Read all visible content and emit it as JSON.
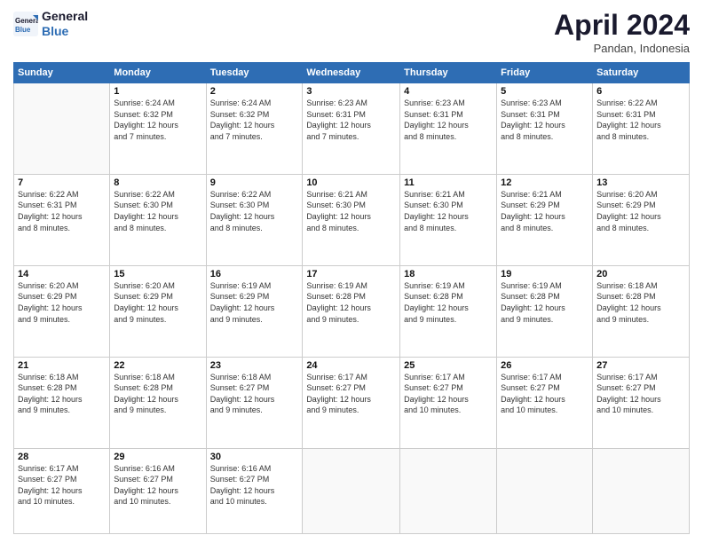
{
  "logo": {
    "line1": "General",
    "line2": "Blue"
  },
  "header": {
    "month": "April 2024",
    "location": "Pandan, Indonesia"
  },
  "days_of_week": [
    "Sunday",
    "Monday",
    "Tuesday",
    "Wednesday",
    "Thursday",
    "Friday",
    "Saturday"
  ],
  "weeks": [
    [
      {
        "day": "",
        "info": ""
      },
      {
        "day": "1",
        "info": "Sunrise: 6:24 AM\nSunset: 6:32 PM\nDaylight: 12 hours\nand 7 minutes."
      },
      {
        "day": "2",
        "info": "Sunrise: 6:24 AM\nSunset: 6:32 PM\nDaylight: 12 hours\nand 7 minutes."
      },
      {
        "day": "3",
        "info": "Sunrise: 6:23 AM\nSunset: 6:31 PM\nDaylight: 12 hours\nand 7 minutes."
      },
      {
        "day": "4",
        "info": "Sunrise: 6:23 AM\nSunset: 6:31 PM\nDaylight: 12 hours\nand 8 minutes."
      },
      {
        "day": "5",
        "info": "Sunrise: 6:23 AM\nSunset: 6:31 PM\nDaylight: 12 hours\nand 8 minutes."
      },
      {
        "day": "6",
        "info": "Sunrise: 6:22 AM\nSunset: 6:31 PM\nDaylight: 12 hours\nand 8 minutes."
      }
    ],
    [
      {
        "day": "7",
        "info": "Sunrise: 6:22 AM\nSunset: 6:31 PM\nDaylight: 12 hours\nand 8 minutes."
      },
      {
        "day": "8",
        "info": "Sunrise: 6:22 AM\nSunset: 6:30 PM\nDaylight: 12 hours\nand 8 minutes."
      },
      {
        "day": "9",
        "info": "Sunrise: 6:22 AM\nSunset: 6:30 PM\nDaylight: 12 hours\nand 8 minutes."
      },
      {
        "day": "10",
        "info": "Sunrise: 6:21 AM\nSunset: 6:30 PM\nDaylight: 12 hours\nand 8 minutes."
      },
      {
        "day": "11",
        "info": "Sunrise: 6:21 AM\nSunset: 6:30 PM\nDaylight: 12 hours\nand 8 minutes."
      },
      {
        "day": "12",
        "info": "Sunrise: 6:21 AM\nSunset: 6:29 PM\nDaylight: 12 hours\nand 8 minutes."
      },
      {
        "day": "13",
        "info": "Sunrise: 6:20 AM\nSunset: 6:29 PM\nDaylight: 12 hours\nand 8 minutes."
      }
    ],
    [
      {
        "day": "14",
        "info": "Sunrise: 6:20 AM\nSunset: 6:29 PM\nDaylight: 12 hours\nand 9 minutes."
      },
      {
        "day": "15",
        "info": "Sunrise: 6:20 AM\nSunset: 6:29 PM\nDaylight: 12 hours\nand 9 minutes."
      },
      {
        "day": "16",
        "info": "Sunrise: 6:19 AM\nSunset: 6:29 PM\nDaylight: 12 hours\nand 9 minutes."
      },
      {
        "day": "17",
        "info": "Sunrise: 6:19 AM\nSunset: 6:28 PM\nDaylight: 12 hours\nand 9 minutes."
      },
      {
        "day": "18",
        "info": "Sunrise: 6:19 AM\nSunset: 6:28 PM\nDaylight: 12 hours\nand 9 minutes."
      },
      {
        "day": "19",
        "info": "Sunrise: 6:19 AM\nSunset: 6:28 PM\nDaylight: 12 hours\nand 9 minutes."
      },
      {
        "day": "20",
        "info": "Sunrise: 6:18 AM\nSunset: 6:28 PM\nDaylight: 12 hours\nand 9 minutes."
      }
    ],
    [
      {
        "day": "21",
        "info": "Sunrise: 6:18 AM\nSunset: 6:28 PM\nDaylight: 12 hours\nand 9 minutes."
      },
      {
        "day": "22",
        "info": "Sunrise: 6:18 AM\nSunset: 6:28 PM\nDaylight: 12 hours\nand 9 minutes."
      },
      {
        "day": "23",
        "info": "Sunrise: 6:18 AM\nSunset: 6:27 PM\nDaylight: 12 hours\nand 9 minutes."
      },
      {
        "day": "24",
        "info": "Sunrise: 6:17 AM\nSunset: 6:27 PM\nDaylight: 12 hours\nand 9 minutes."
      },
      {
        "day": "25",
        "info": "Sunrise: 6:17 AM\nSunset: 6:27 PM\nDaylight: 12 hours\nand 10 minutes."
      },
      {
        "day": "26",
        "info": "Sunrise: 6:17 AM\nSunset: 6:27 PM\nDaylight: 12 hours\nand 10 minutes."
      },
      {
        "day": "27",
        "info": "Sunrise: 6:17 AM\nSunset: 6:27 PM\nDaylight: 12 hours\nand 10 minutes."
      }
    ],
    [
      {
        "day": "28",
        "info": "Sunrise: 6:17 AM\nSunset: 6:27 PM\nDaylight: 12 hours\nand 10 minutes."
      },
      {
        "day": "29",
        "info": "Sunrise: 6:16 AM\nSunset: 6:27 PM\nDaylight: 12 hours\nand 10 minutes."
      },
      {
        "day": "30",
        "info": "Sunrise: 6:16 AM\nSunset: 6:27 PM\nDaylight: 12 hours\nand 10 minutes."
      },
      {
        "day": "",
        "info": ""
      },
      {
        "day": "",
        "info": ""
      },
      {
        "day": "",
        "info": ""
      },
      {
        "day": "",
        "info": ""
      }
    ]
  ]
}
